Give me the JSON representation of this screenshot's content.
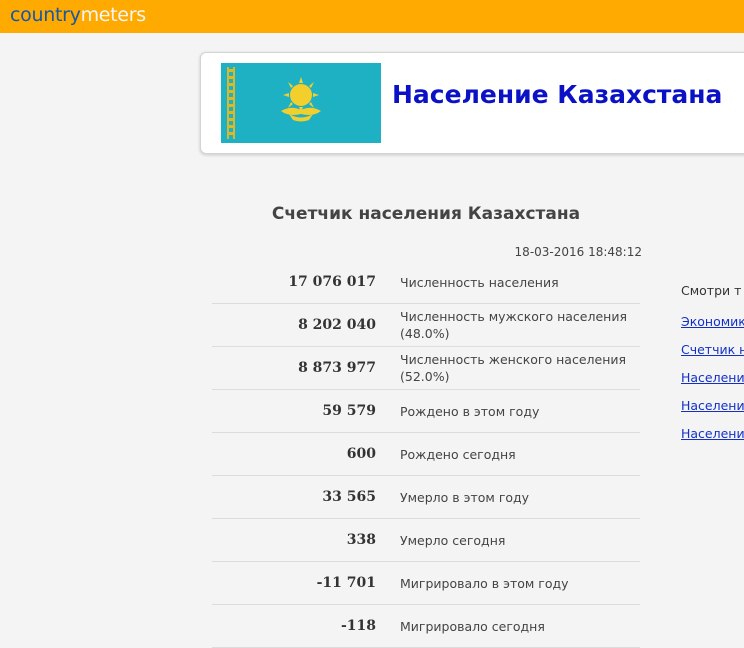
{
  "logo": {
    "part1": "country",
    "part2": "meters"
  },
  "header": {
    "title": "Население Казахстана"
  },
  "counter": {
    "title": "Счетчик населения Казахстана",
    "timestamp": "18-03-2016 18:48:12",
    "rows": [
      {
        "value": "17 076 017",
        "label": "Численность населения",
        "label2": ""
      },
      {
        "value": "8 202 040",
        "label": "Численность мужского населения",
        "label2": "(48.0%)"
      },
      {
        "value": "8 873 977",
        "label": "Численность женского населения",
        "label2": "(52.0%)"
      },
      {
        "value": "59 579",
        "label": "Рождено в этом году",
        "label2": ""
      },
      {
        "value": "600",
        "label": "Рождено сегодня",
        "label2": ""
      },
      {
        "value": "33 565",
        "label": "Умерло в этом году",
        "label2": ""
      },
      {
        "value": "338",
        "label": "Умерло сегодня",
        "label2": ""
      },
      {
        "value": "-11 701",
        "label": "Мигрировало в этом году",
        "label2": ""
      },
      {
        "value": "-118",
        "label": "Мигрировало сегодня",
        "label2": ""
      }
    ]
  },
  "sidebar": {
    "see_also": "Смотри т",
    "links": [
      "Экономик",
      "Счетчик н",
      "Населени",
      "Населени",
      "Населени"
    ]
  },
  "colors": {
    "topbar": "#ffaa00",
    "title": "#0b12c6",
    "flag": "#1eb1c4",
    "link": "#1230c8"
  },
  "icons": {
    "flag": "kazakhstan-flag-icon"
  }
}
